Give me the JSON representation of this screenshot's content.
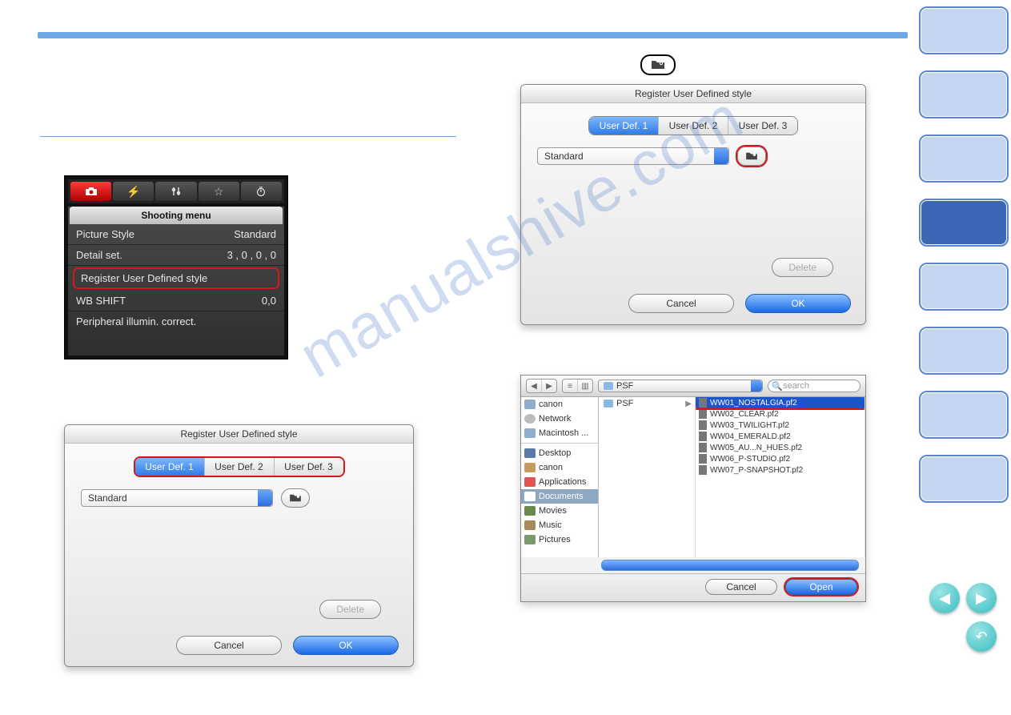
{
  "watermark": "manualshive.com",
  "callout_icon": "folder-camera-icon",
  "shooting_menu": {
    "title": "Shooting menu",
    "tabs_icons": [
      "camera-icon",
      "flash-icon",
      "sliders-icon",
      "star-icon",
      "timer-icon"
    ],
    "rows": [
      {
        "label": "Picture Style",
        "value": "Standard"
      },
      {
        "label": "Detail set.",
        "value": "3 , 0 , 0 , 0"
      },
      {
        "label": "Register User Defined style",
        "value": ""
      },
      {
        "label": "WB SHIFT",
        "value": "0,0"
      },
      {
        "label": "Peripheral illumin. correct.",
        "value": ""
      }
    ]
  },
  "dialog_left": {
    "title": "Register User Defined style",
    "tabs": [
      "User Def. 1",
      "User Def. 2",
      "User Def. 3"
    ],
    "active_tab": 0,
    "dropdown": "Standard",
    "delete": "Delete",
    "cancel": "Cancel",
    "ok": "OK"
  },
  "dialog_right": {
    "title": "Register User Defined style",
    "tabs": [
      "User Def. 1",
      "User Def. 2",
      "User Def. 3"
    ],
    "active_tab": 0,
    "dropdown": "Standard",
    "delete": "Delete",
    "cancel": "Cancel",
    "ok": "OK"
  },
  "file_chooser": {
    "path_popup": "PSF",
    "search_placeholder": "search",
    "sidebar": [
      "canon",
      "Network",
      "Macintosh ...",
      "Desktop",
      "canon",
      "Applications",
      "Documents",
      "Movies",
      "Music",
      "Pictures"
    ],
    "col1": [
      {
        "name": "PSF",
        "is_folder": true
      }
    ],
    "files": [
      "WW01_NOSTALGIA.pf2",
      "WW02_CLEAR.pf2",
      "WW03_TWILIGHT.pf2",
      "WW04_EMERALD.pf2",
      "WW05_AU...N_HUES.pf2",
      "WW06_P-STUDIO.pf2",
      "WW07_P-SNAPSHOT.pf2"
    ],
    "selected_file_index": 0,
    "cancel": "Cancel",
    "open": "Open"
  }
}
